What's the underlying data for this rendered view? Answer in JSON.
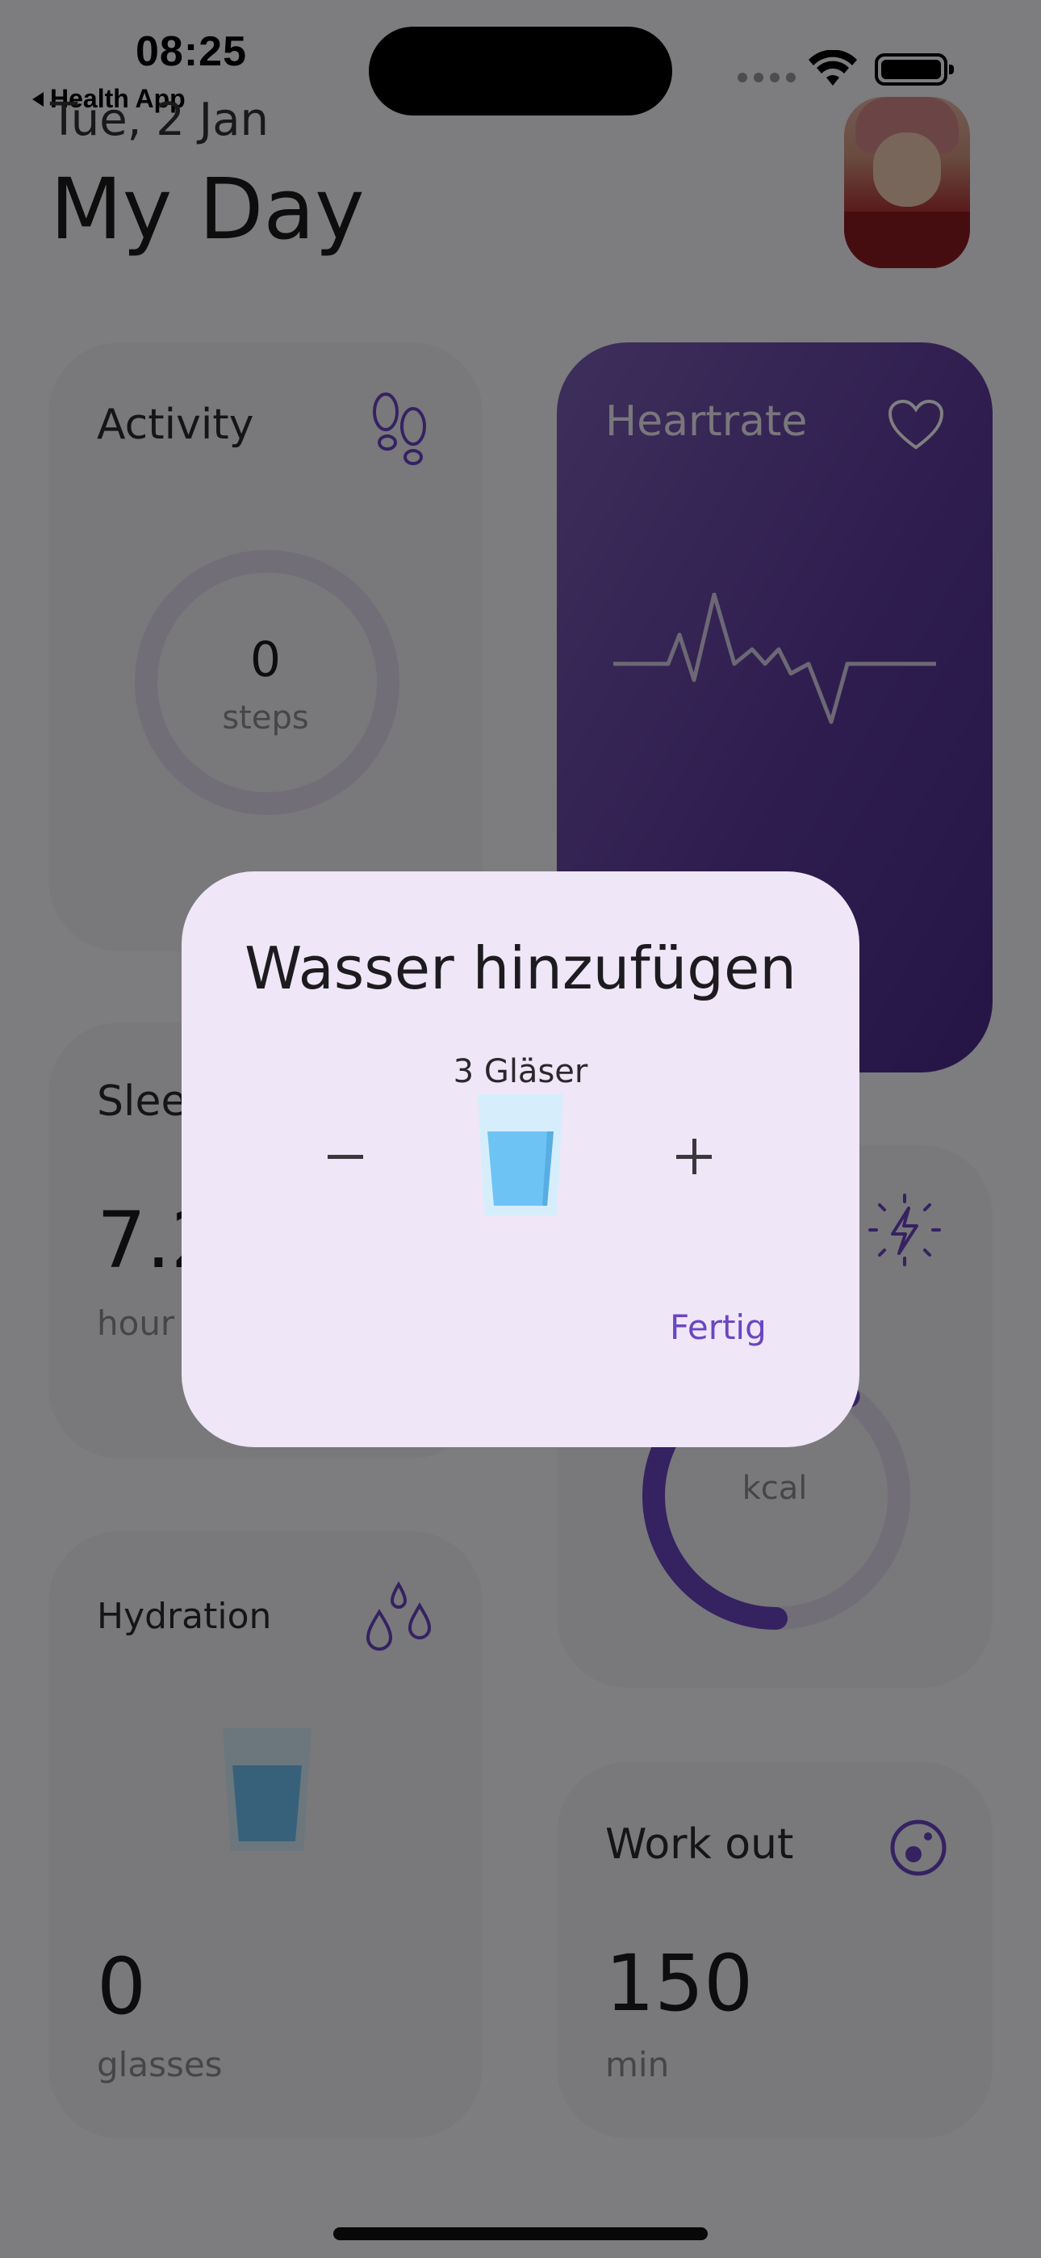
{
  "status_bar": {
    "time": "08:25",
    "back_label": "Health App"
  },
  "header": {
    "date": "Tue, 2 Jan",
    "title": "My Day"
  },
  "cards": {
    "activity": {
      "label": "Activity",
      "value": "0",
      "unit": "steps",
      "icon": "footsteps-icon"
    },
    "heartrate": {
      "label": "Heartrate",
      "icon": "heart-icon"
    },
    "sleep": {
      "label": "Slee",
      "value": "7.2",
      "unit": "hour"
    },
    "energy": {
      "unit": "kcal",
      "icon": "lightning-icon",
      "ring_fill": 0.6
    },
    "hydration": {
      "label": "Hydration",
      "value": "0",
      "unit": "glasses",
      "icon": "water-drops-icon"
    },
    "workout": {
      "label": "Work out",
      "value": "150",
      "unit": "min",
      "icon": "workout-icon"
    }
  },
  "dialog": {
    "title": "Wasser hinzufügen",
    "count_label": "3 Gläser",
    "done_label": "Fertig"
  },
  "colors": {
    "accent": "#6b45c2",
    "heartrate_card": "#5e3a9e",
    "dialog_bg": "#efe6f7",
    "water": "#6ec3f5"
  }
}
